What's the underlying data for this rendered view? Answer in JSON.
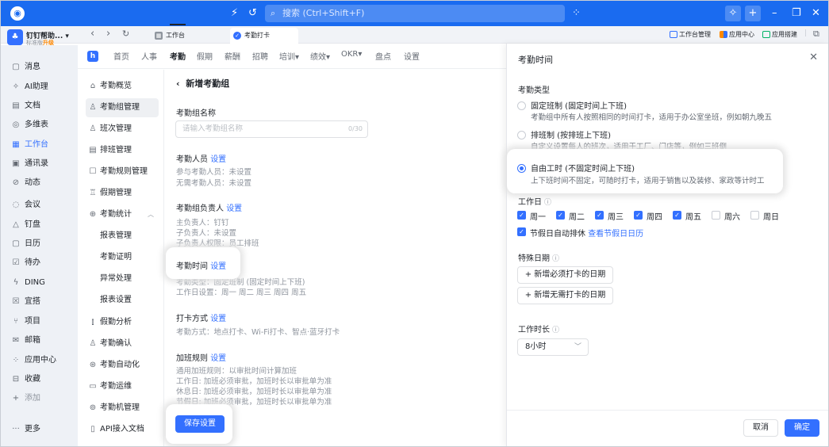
{
  "topbar": {
    "search_placeholder": "搜索 (Ctrl+Shift+F)",
    "colors": {
      "bg": "#1a6bf0"
    }
  },
  "org": {
    "name": "钉钉帮助...",
    "edition": "标准版",
    "upgrade": "升级"
  },
  "tabs": [
    {
      "label": "工作台"
    },
    {
      "label": "考勤打卡"
    }
  ],
  "right_links": [
    "工作台管理",
    "应用中心",
    "应用搭建"
  ],
  "sidebar": {
    "items": [
      {
        "label": "消息",
        "icon": "message-icon"
      },
      {
        "label": "AI助理",
        "icon": "ai-icon"
      },
      {
        "label": "文档",
        "icon": "doc-icon"
      },
      {
        "label": "多维表",
        "icon": "table-icon"
      },
      {
        "label": "工作台",
        "icon": "grid-icon"
      },
      {
        "label": "通讯录",
        "icon": "contacts-icon"
      },
      {
        "label": "动态",
        "icon": "feed-icon"
      },
      {
        "label": "会议",
        "icon": "meeting-icon"
      },
      {
        "label": "钉盘",
        "icon": "drive-icon"
      },
      {
        "label": "日历",
        "icon": "calendar-icon"
      },
      {
        "label": "待办",
        "icon": "todo-icon"
      },
      {
        "label": "DING",
        "icon": "ding-icon"
      },
      {
        "label": "宜搭",
        "icon": "yida-icon"
      },
      {
        "label": "项目",
        "icon": "project-icon"
      },
      {
        "label": "邮箱",
        "icon": "mail-icon"
      },
      {
        "label": "应用中心",
        "icon": "apps-icon"
      },
      {
        "label": "收藏",
        "icon": "favorite-icon"
      },
      {
        "label": "添加",
        "icon": "plus-icon"
      },
      {
        "label": "更多",
        "icon": "more-icon"
      }
    ],
    "active": "工作台"
  },
  "app_nav": {
    "items": [
      "首页",
      "人事",
      "考勤",
      "假期",
      "薪酬",
      "招聘",
      "培训▾",
      "绩效▾",
      "OKR▾",
      "盘点",
      "设置"
    ],
    "active": "考勤"
  },
  "module_menu": {
    "items": [
      {
        "label": "考勤概览",
        "icon": "home-icon"
      },
      {
        "label": "考勤组管理",
        "icon": "group-icon"
      },
      {
        "label": "班次管理",
        "icon": "shift-icon"
      },
      {
        "label": "排班管理",
        "icon": "schedule-icon"
      },
      {
        "label": "考勤规则管理",
        "icon": "rule-icon"
      },
      {
        "label": "假期管理",
        "icon": "holiday-icon"
      },
      {
        "label": "考勤统计",
        "icon": "stats-icon"
      },
      {
        "label": "报表管理",
        "icon": ""
      },
      {
        "label": "考勤证明",
        "icon": ""
      },
      {
        "label": "异常处理",
        "icon": ""
      },
      {
        "label": "报表设置",
        "icon": ""
      },
      {
        "label": "假勤分析",
        "icon": "chart-icon"
      },
      {
        "label": "考勤确认",
        "icon": "confirm-icon"
      },
      {
        "label": "考勤自动化",
        "icon": "auto-icon"
      },
      {
        "label": "考勤运维",
        "icon": "ops-icon"
      },
      {
        "label": "考勤机管理",
        "icon": "machine-icon"
      },
      {
        "label": "API接入文档",
        "icon": "api-icon"
      }
    ],
    "active": "考勤组管理"
  },
  "form": {
    "title": "新增考勤组",
    "name_label": "考勤组名称",
    "name_placeholder": "请输入考勤组名称",
    "name_count": "0/30",
    "members_label": "考勤人员",
    "set": "设置",
    "members_lines": [
      "参与考勤人员：未设置",
      "无需考勤人员：未设置"
    ],
    "owner_label": "考勤组负责人",
    "owner_lines": [
      "主负责人：钉钉",
      "子负责人：未设置",
      "子负责人权限：员工排班"
    ],
    "time_label": "考勤时间",
    "time_lines": [
      "考勤类型：固定班制 (固定时间上下班)",
      "工作日设置：周一 周二 周三 周四 周五"
    ],
    "punch_label": "打卡方式",
    "punch_lines": [
      "考勤方式：地点打卡、Wi-Fi打卡、智点·蓝牙打卡"
    ],
    "ot_label": "加班规则",
    "ot_lines": [
      "通用加班规则：以审批时间计算加班",
      "工作日: 加班必须审批，加班时长以审批单为准",
      "休息日: 加班必须审批，加班时长以审批单为准",
      "节假日: 加班必须审批，加班时长以审批单为准"
    ],
    "save": "保存设置"
  },
  "panel": {
    "title": "考勤时间",
    "type_label": "考勤类型",
    "options": [
      {
        "title": "固定班制 (固定时间上下班)",
        "desc": "考勤组中所有人按照相同的时间打卡，适用于办公室坐班，例如朝九晚五",
        "selected": false
      },
      {
        "title": "排班制 (按排班上下班)",
        "desc": "自定义设置每人的班次，适用于工厂、门店等，例如三班倒",
        "selected": false
      },
      {
        "title": "自由工时 (不固定时间上下班)",
        "desc": "上下班时间不固定，可随时打卡，适用于销售以及装修、家政等计时工",
        "selected": true
      }
    ],
    "workday_label": "工作日",
    "days": [
      {
        "label": "周一",
        "checked": true
      },
      {
        "label": "周二",
        "checked": true
      },
      {
        "label": "周三",
        "checked": true
      },
      {
        "label": "周四",
        "checked": true
      },
      {
        "label": "周五",
        "checked": true
      },
      {
        "label": "周六",
        "checked": false
      },
      {
        "label": "周日",
        "checked": false
      }
    ],
    "holiday_rest": "节假日自动排休",
    "holiday_link": "查看节假日日历",
    "special_label": "特殊日期",
    "add_must": "+ 新增必须打卡的日期",
    "add_no": "+ 新增无需打卡的日期",
    "duration_label": "工作时长",
    "duration_value": "8小时",
    "cancel": "取消",
    "ok": "确定"
  }
}
